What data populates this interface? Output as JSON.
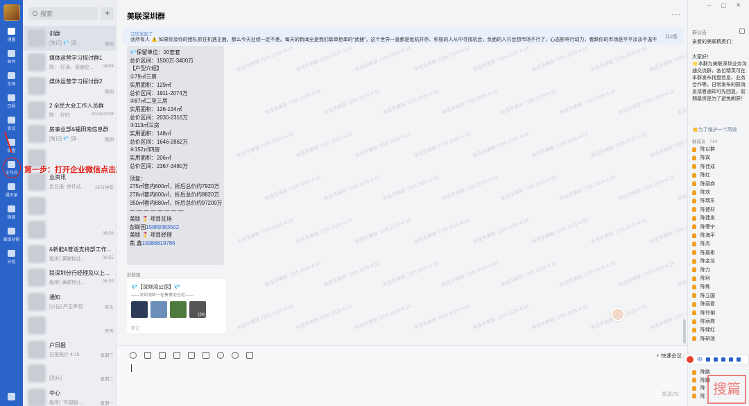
{
  "rail": {
    "items": [
      {
        "label": "消息",
        "icon": "message-icon",
        "active": true
      },
      {
        "label": "邮件",
        "icon": "mail-icon"
      },
      {
        "label": "文档",
        "icon": "document-icon"
      },
      {
        "label": "日程",
        "icon": "calendar-icon"
      },
      {
        "label": "会议",
        "icon": "meeting-icon"
      },
      {
        "label": "微盘",
        "icon": "drive-icon"
      },
      {
        "label": "工作台",
        "icon": "workbench-icon"
      },
      {
        "label": "通讯录",
        "icon": "contacts-icon"
      },
      {
        "label": "微盘",
        "icon": "storage-icon"
      },
      {
        "label": "高级功能",
        "icon": "advanced-icon"
      },
      {
        "label": "分组",
        "icon": "group-icon"
      }
    ]
  },
  "annotation": {
    "text": "第一步：打开企业微信点击工作台",
    "color": "#e2231a"
  },
  "search": {
    "placeholder": "搜索",
    "add": "+"
  },
  "conversations": [
    {
      "name": "训群",
      "preview": "[笔记] 💎 [深...",
      "time": "刚刚"
    },
    {
      "name": "媒体运营学习探讨群1",
      "preview": "陈： 好滴，感谢史...",
      "time": "04/08"
    },
    {
      "name": "媒体运营学习探讨群2",
      "preview": "",
      "time": "刚刚"
    },
    {
      "name": "2 全民大会工作人员群",
      "preview": "陈： 好的",
      "time": "2024/02/28"
    },
    {
      "name": "房事业部&福田南信息群",
      "preview": "[笔记] 💎 [深...",
      "time": "刚刚"
    },
    {
      "name": "",
      "preview": "",
      "time": ""
    },
    {
      "name": "业资讯",
      "preview": "启日报: 房件达...",
      "time": "55分钟前"
    },
    {
      "name": "",
      "preview": "",
      "time": ""
    },
    {
      "name": "",
      "preview": "",
      "time": "08:56"
    },
    {
      "name": "&新能&普适支持部工作...",
      "preview": "程序] 满联物业...",
      "time": "08:55"
    },
    {
      "name": "联深圳分行经理及以上...",
      "preview": "程序] 满联物业...",
      "time": "08:55"
    },
    {
      "name": "通知",
      "preview": "[公告] 严正声明",
      "time": "昨天"
    },
    {
      "name": "",
      "preview": "",
      "time": "昨天"
    },
    {
      "name": "户日报",
      "preview": "日报统计 4:15",
      "time": "星期三"
    },
    {
      "name": "",
      "preview": "[图片]",
      "time": "星期二"
    },
    {
      "name": "中心",
      "preview": "程序] \"中国服...",
      "time": "星期一"
    }
  ],
  "chat": {
    "title": "美联深圳群",
    "more": "···",
    "notice": {
      "head": "江欣发起了",
      "text": "@所有人 ⚠️ 如果你及你的团队抓住机遇正面，那么今天业绩一定不差。每天的新闻全是我们敌单抢单的“武器”，这个世界一直都是危机并存、积极的人从中寻找机会，负面的人只会想市场不行了，心态影响行动力，看跌你的市场是平平淡淡不温不火，相反...",
      "count": "共2条"
    },
    "message": {
      "lines": [
        "💎保留单位：20套套",
        "总价区间：1500万-3400万",
        "【户型介绍】",
        "①79㎡三房",
        "实用面积：129㎡",
        "总价区间：1911-2074万",
        "②87㎡二至三房",
        "实用面积：126-134㎡",
        "总价区间：2030-2316万",
        "③113㎡三房",
        "实用面积：148㎡",
        "总价区间：1646-2862万",
        "④152㎡四房",
        "实用面积：206㎡",
        "总价区间：2367-3480万"
      ],
      "lines2": [
        "顶复：",
        "275㎡套内600㎡，折后总价约7920万",
        "278㎡套内600㎡，折后总价约8820万",
        "350㎡套内880㎡，折后总价约97200万",
        "— — — — — — — —"
      ],
      "contacts": [
        {
          "label": "美联 🎖️ 项目驻场",
          "tel": ""
        },
        {
          "label": "彭断国",
          "tel": "15889383502"
        },
        {
          "label": "美联 🎖️ 项目经理",
          "tel": ""
        },
        {
          "label": "焦 鑫",
          "tel": "15986819786"
        }
      ]
    },
    "sender2": "彭断国",
    "card": {
      "title": "💎【深圳湾公馆】💎",
      "subtitle": "——深圳湾畔一在售豪宅住宅——",
      "footer": "笔记",
      "thumb_badge": "(24)"
    },
    "watermark": "宋佳华美联 7205\n2025-4-18",
    "input": {
      "quick_reply": "⚡ 快速会议",
      "send": "发送(S)"
    }
  },
  "right": {
    "window_controls": "─ ▢ ✕",
    "header": "群公告",
    "greeting": "亲爱的美联精英们：",
    "body": "大家好！\n🌟本群为美联深圳业务沟通交流群，各位精英可在本群发布找盘信息、业务合作等，日常发布的群消息或者通知可先回复，前期基资是为了避免刷屏！",
    "link": "👏为了维护一个高效",
    "members_header": "群成员 · 714",
    "members": [
      "陈以群",
      "陈宾",
      "陈佳成",
      "陈红",
      "陈丽商",
      "陈欢",
      "陈瑞东",
      "陈健材",
      "陈建发",
      "陈寒宁",
      "陈海平",
      "陈杰",
      "陈嘉彬",
      "陈金龙",
      "陈力",
      "陈利",
      "陈练",
      "陈立国",
      "陈丽君",
      "陈玲俐",
      "陈丽商",
      "陈绿红",
      "陈研泼"
    ],
    "members_bottom": [
      "陈鹏",
      "陈鹏",
      "陈",
      "陈"
    ]
  },
  "ime": {
    "text": "中"
  },
  "stamp": {
    "text": "搜篇"
  }
}
